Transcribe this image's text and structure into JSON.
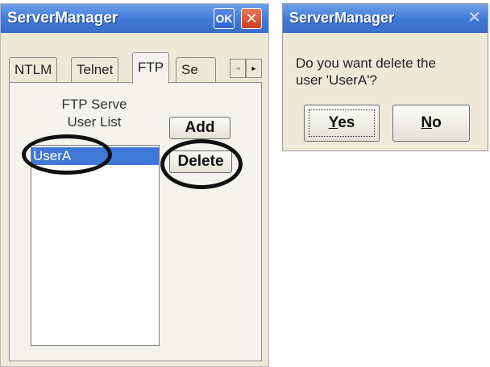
{
  "main_window": {
    "title": "ServerManager",
    "ok_label": "OK",
    "close_label": "✕",
    "tabs": [
      {
        "label": "NTLM"
      },
      {
        "label": "Telnet"
      },
      {
        "label": "FTP"
      },
      {
        "label": "Se"
      }
    ],
    "tab_scroll_left": "◂",
    "tab_scroll_right": "▸",
    "list_label_line1": "FTP Serve",
    "list_label_line2": "User List",
    "users": [
      "UserA"
    ],
    "add_button": "Add",
    "delete_button": "Delete"
  },
  "dialog": {
    "title": "ServerManager",
    "close_label": "✕",
    "message_line1": "Do you want delete the",
    "message_line2": "user 'UserA'?",
    "yes_first": "Y",
    "yes_rest": "es",
    "no_first": "N",
    "no_rest": "o"
  },
  "colors": {
    "titlebar": "#3f78d6",
    "selection": "#3f78d6",
    "window_face": "#ece9d8",
    "annotation_ring": "#111111"
  }
}
